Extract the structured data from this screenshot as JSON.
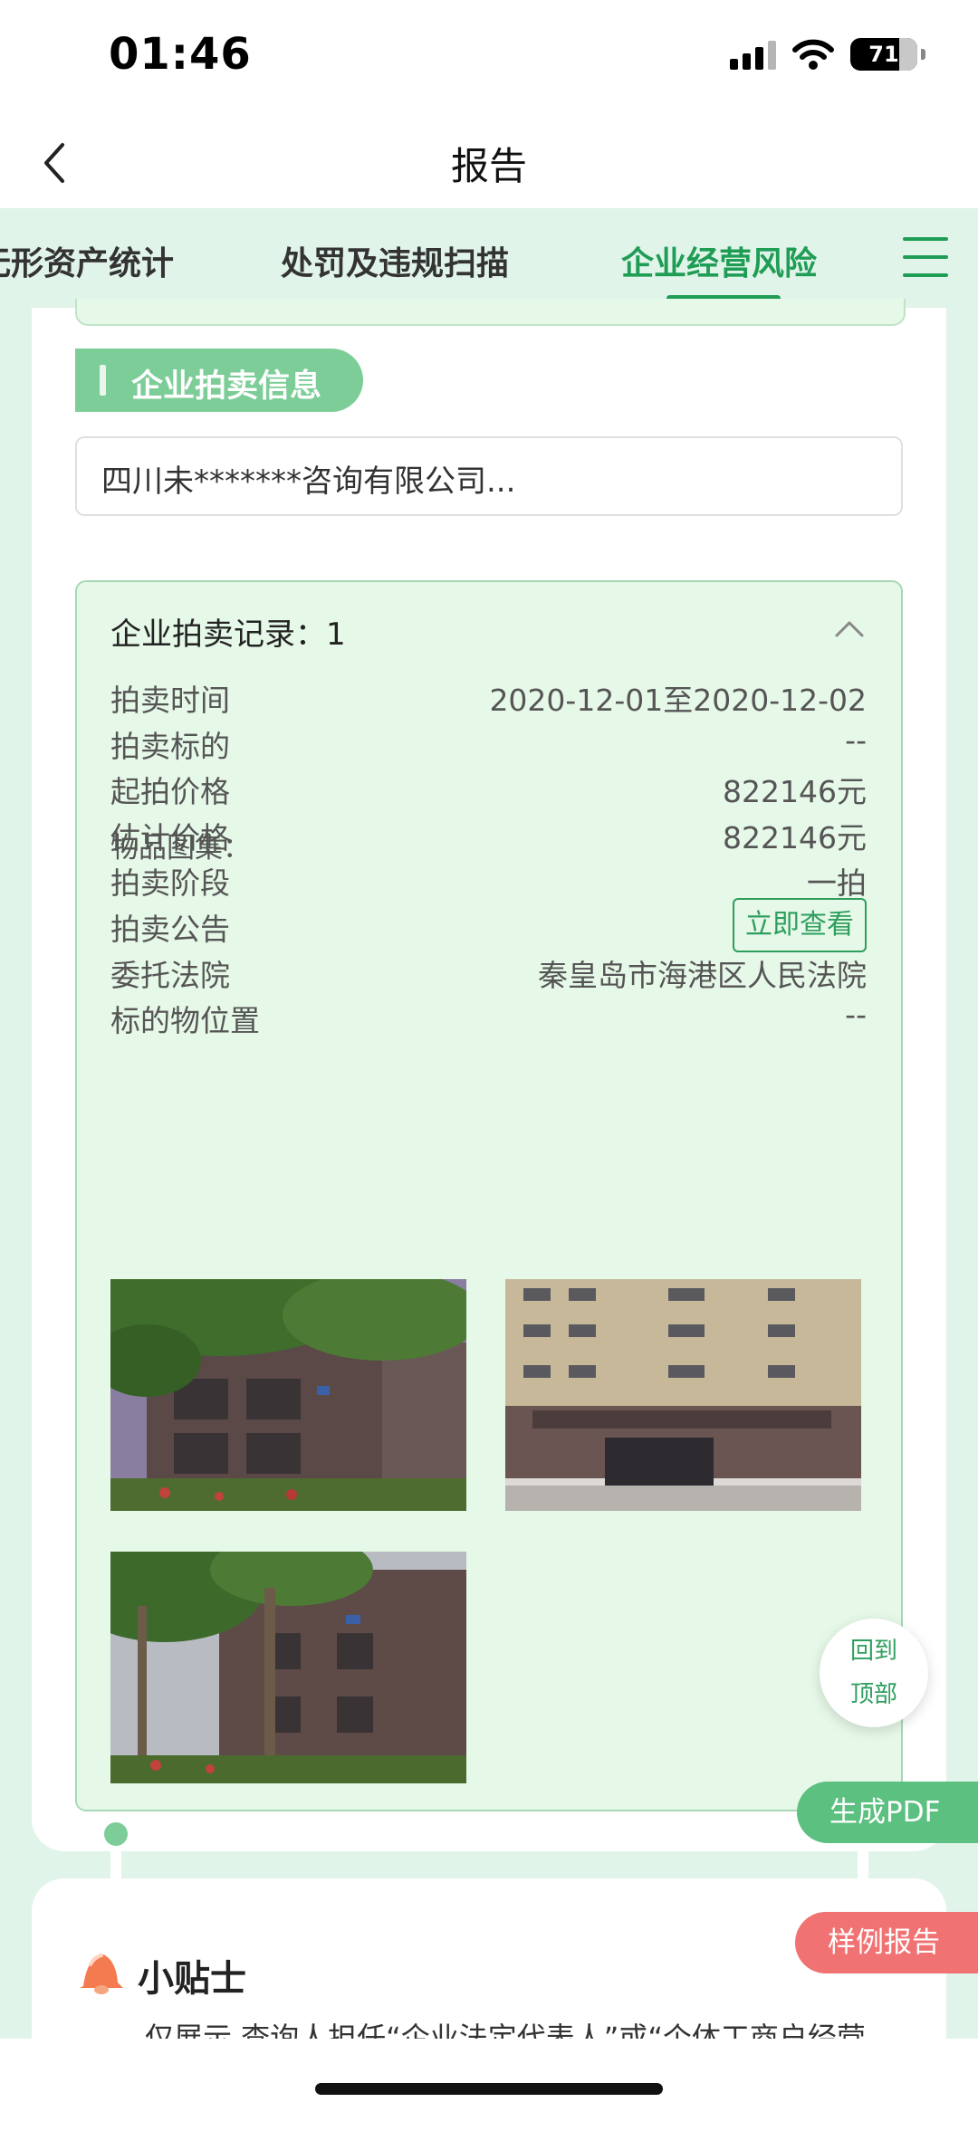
{
  "status_bar": {
    "time": "01:46",
    "battery": "71"
  },
  "nav": {
    "title": "报告"
  },
  "tabs": [
    {
      "label": "无形资产统计"
    },
    {
      "label": "处罚及违规扫描"
    },
    {
      "label": "企业经营风险"
    }
  ],
  "section": {
    "title": "企业拍卖信息"
  },
  "company_select": {
    "value": "四川未*******咨询有限公司..."
  },
  "record": {
    "header": "企业拍卖记录：1",
    "rows": [
      {
        "key": "拍卖时间",
        "value": "2020-12-01至2020-12-02"
      },
      {
        "key": "拍卖标的",
        "value": "--"
      },
      {
        "key": "起拍价格",
        "value": "822146元"
      },
      {
        "key": "估计价格",
        "value": "822146元"
      },
      {
        "key": "拍卖阶段",
        "value": "一拍"
      },
      {
        "key": "拍卖公告",
        "value": "立即查看"
      },
      {
        "key": "委托法院",
        "value": "秦皇岛市海港区人民法院"
      },
      {
        "key": "标的物位置",
        "value": "--"
      }
    ],
    "gallery_label": "物品图集："
  },
  "floating": {
    "back_to_top": [
      "回到",
      "顶部"
    ],
    "generate_pdf": "生成PDF",
    "sample_report": "样例报告"
  },
  "tips": {
    "title": "小贴士",
    "text": "仅展示 查询人担任“企业法定代表人”或“个体工商户经营"
  },
  "colors": {
    "accent": "#1f9d55",
    "tab_bg": "#e1f4ea",
    "record_bg": "#e6f8e8",
    "pdf_button": "#5cc080",
    "sample_button": "#f07272"
  }
}
